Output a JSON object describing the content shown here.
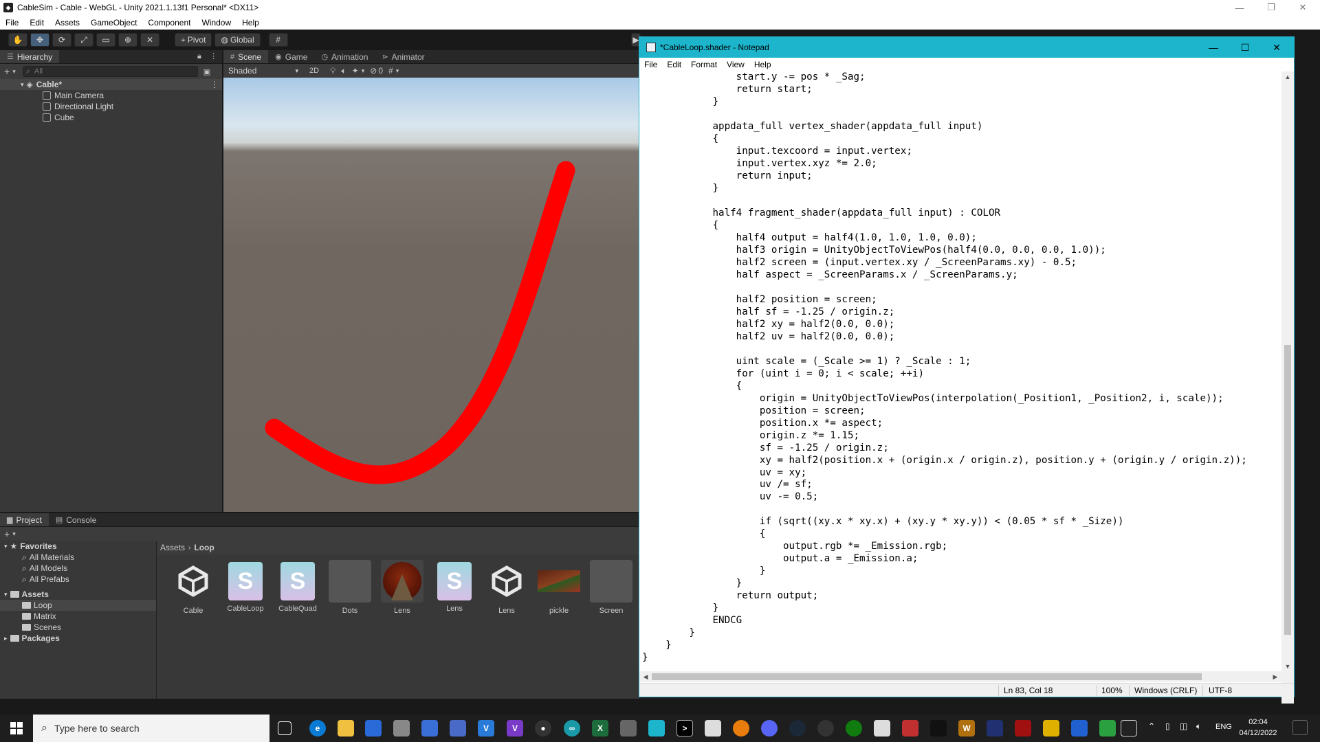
{
  "unity": {
    "title": "CableSim - Cable - WebGL - Unity 2021.1.13f1 Personal* <DX11>",
    "menu": [
      "File",
      "Edit",
      "Assets",
      "GameObject",
      "Component",
      "Window",
      "Help"
    ],
    "toolbar": {
      "pivot": "Pivot",
      "global": "Global"
    },
    "hierarchy": {
      "tab": "Hierarchy",
      "search_placeholder": "All",
      "scene": "Cable*",
      "items": [
        "Main Camera",
        "Directional Light",
        "Cube"
      ]
    },
    "scene_panel": {
      "tabs": [
        "Scene",
        "Game",
        "Animation",
        "Animator"
      ],
      "shading": "Shaded",
      "mode_2d": "2D",
      "hidden_count": "0"
    },
    "project": {
      "tabs": [
        "Project",
        "Console"
      ],
      "tree": {
        "favorites": "Favorites",
        "favorites_items": [
          "All Materials",
          "All Models",
          "All Prefabs"
        ],
        "assets": "Assets",
        "assets_items": [
          "Loop",
          "Matrix",
          "Scenes"
        ],
        "packages": "Packages"
      },
      "breadcrumb": [
        "Assets",
        "Loop"
      ],
      "assets": [
        {
          "label": "Cable",
          "kind": "unity"
        },
        {
          "label": "CableLoop",
          "kind": "shader"
        },
        {
          "label": "CableQuad",
          "kind": "shader"
        },
        {
          "label": "Dots",
          "kind": "blank"
        },
        {
          "label": "Lens",
          "kind": "material"
        },
        {
          "label": "Lens",
          "kind": "shader"
        },
        {
          "label": "Lens",
          "kind": "unity"
        },
        {
          "label": "pickle",
          "kind": "image"
        },
        {
          "label": "Screen",
          "kind": "blank"
        }
      ]
    }
  },
  "notepad": {
    "title": "*CableLoop.shader - Notepad",
    "menu": [
      "File",
      "Edit",
      "Format",
      "View",
      "Help"
    ],
    "code": "                start.y -= pos * _Sag;\n                return start;\n            }\n\n            appdata_full vertex_shader(appdata_full input)\n            {\n                input.texcoord = input.vertex;\n                input.vertex.xyz *= 2.0;\n                return input;\n            }\n\n            half4 fragment_shader(appdata_full input) : COLOR\n            {\n                half4 output = half4(1.0, 1.0, 1.0, 0.0);\n                half3 origin = UnityObjectToViewPos(half4(0.0, 0.0, 0.0, 1.0));\n                half2 screen = (input.vertex.xy / _ScreenParams.xy) - 0.5;\n                half aspect = _ScreenParams.x / _ScreenParams.y;\n\n                half2 position = screen;\n                half sf = -1.25 / origin.z;\n                half2 xy = half2(0.0, 0.0);\n                half2 uv = half2(0.0, 0.0);\n\n                uint scale = (_Scale >= 1) ? _Scale : 1;\n                for (uint i = 0; i < scale; ++i)\n                {\n                    origin = UnityObjectToViewPos(interpolation(_Position1, _Position2, i, scale));\n                    position = screen;\n                    position.x *= aspect;\n                    origin.z *= 1.15;\n                    sf = -1.25 / origin.z;\n                    xy = half2(position.x + (origin.x / origin.z), position.y + (origin.y / origin.z));\n                    uv = xy;\n                    uv /= sf;\n                    uv -= 0.5;\n\n                    if (sqrt((xy.x * xy.x) + (xy.y * xy.y)) < (0.05 * sf * _Size))\n                    {\n                        output.rgb *= _Emission.rgb;\n                        output.a = _Emission.a;\n                    }\n                }\n                return output;\n            }\n            ENDCG\n        }\n    }\n}",
    "status": {
      "position": "Ln 83, Col 18",
      "zoom": "100%",
      "line_endings": "Windows (CRLF)",
      "encoding": "UTF-8"
    }
  },
  "taskbar": {
    "search_placeholder": "Type here to search",
    "language": "ENG",
    "time": "02:04",
    "date": "04/12/2022"
  },
  "colors": {
    "cable": "#ff0000",
    "notepad_title": "#1cb5cc",
    "unity_dark": "#383838"
  }
}
